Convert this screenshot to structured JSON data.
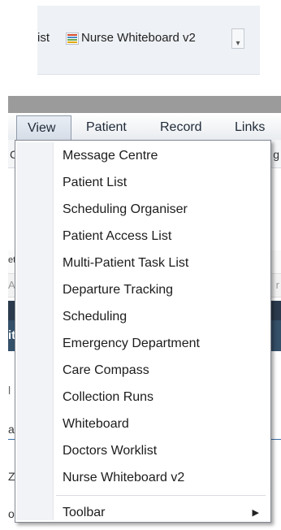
{
  "toolbar": {
    "prev_item_fragment": "ist",
    "nurse_whiteboard_label": "Nurse Whiteboard v2",
    "overflow_glyph": "▾"
  },
  "menubar": {
    "items": [
      "View",
      "Patient",
      "Record",
      "Links"
    ]
  },
  "background_fragments": {
    "c": "C",
    "g": "g",
    "et": "et",
    "ac": "Ac",
    "r": "r",
    "it_bold": "it",
    "l": "l",
    "ai": "ai",
    "z": "Z",
    "o": "o"
  },
  "view_menu": {
    "items": [
      "Message Centre",
      "Patient List",
      "Scheduling Organiser",
      "Patient Access List",
      "Multi-Patient Task List",
      "Departure Tracking",
      "Scheduling",
      "Emergency Department",
      "Care Compass",
      "Collection Runs",
      "Whiteboard",
      "Doctors Worklist",
      "Nurse Whiteboard v2"
    ],
    "submenu_item": "Toolbar",
    "submenu_arrow": "▶"
  },
  "colors": {
    "menubar_bg": "#eef0f3",
    "dark_band": "#2b3b4d",
    "highlight_view": "#dbe2eb"
  }
}
